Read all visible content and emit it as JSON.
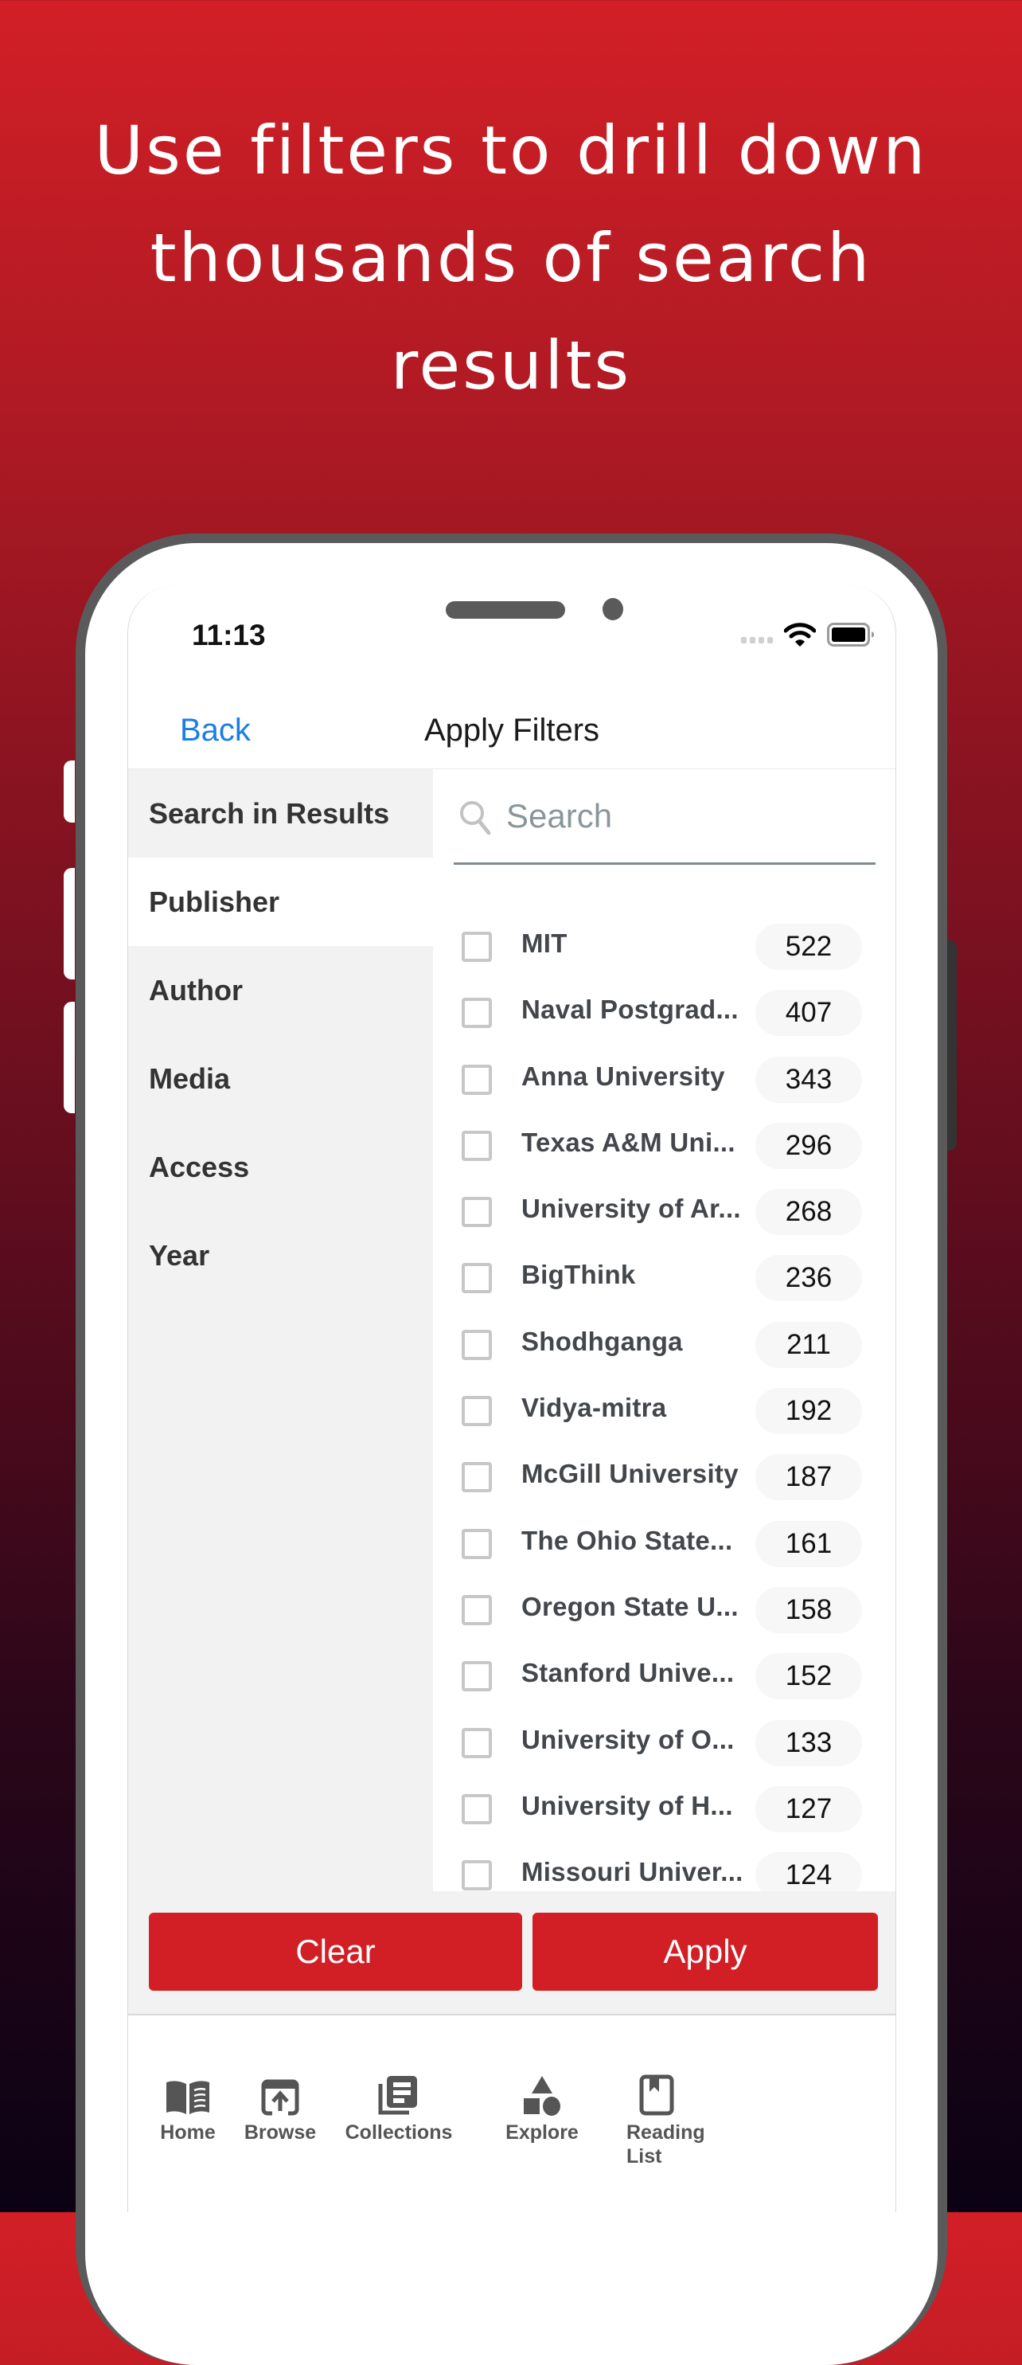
{
  "headline": {
    "lines": [
      "Use filters to drill down",
      "thousands of search",
      "results"
    ]
  },
  "status_bar": {
    "time": "11:13"
  },
  "navbar": {
    "back_label": "Back",
    "title": "Apply Filters"
  },
  "sidebar": {
    "items": [
      {
        "label": "Search in Results",
        "active": false
      },
      {
        "label": "Publisher",
        "active": true
      },
      {
        "label": "Author",
        "active": false
      },
      {
        "label": "Media",
        "active": false
      },
      {
        "label": "Access",
        "active": false
      },
      {
        "label": "Year",
        "active": false
      }
    ]
  },
  "search": {
    "placeholder": "Search",
    "value": ""
  },
  "publishers": [
    {
      "name": "MIT",
      "count": "522",
      "checked": false
    },
    {
      "name": "Naval Postgrad...",
      "count": "407",
      "checked": false
    },
    {
      "name": "Anna University",
      "count": "343",
      "checked": false
    },
    {
      "name": "Texas A&M Uni...",
      "count": "296",
      "checked": false
    },
    {
      "name": "University of Ar...",
      "count": "268",
      "checked": false
    },
    {
      "name": "BigThink",
      "count": "236",
      "checked": false
    },
    {
      "name": "Shodhganga",
      "count": "211",
      "checked": false
    },
    {
      "name": "Vidya-mitra",
      "count": "192",
      "checked": false
    },
    {
      "name": "McGill University",
      "count": "187",
      "checked": false
    },
    {
      "name": "The Ohio State...",
      "count": "161",
      "checked": false
    },
    {
      "name": "Oregon State U...",
      "count": "158",
      "checked": false
    },
    {
      "name": "Stanford Unive...",
      "count": "152",
      "checked": false
    },
    {
      "name": "University of O...",
      "count": "133",
      "checked": false
    },
    {
      "name": "University of H...",
      "count": "127",
      "checked": false
    },
    {
      "name": "Missouri Univer...",
      "count": "124",
      "checked": false
    }
  ],
  "actions": {
    "clear_label": "Clear",
    "apply_label": "Apply"
  },
  "tabbar": {
    "items": [
      {
        "label": "Home",
        "icon": "open-book-icon"
      },
      {
        "label": "Browse",
        "icon": "browse-upload-icon"
      },
      {
        "label": "Collections",
        "icon": "collections-stack-icon"
      },
      {
        "label": "Explore",
        "icon": "shapes-icon"
      },
      {
        "label": "Reading\nList",
        "icon": "bookmark-book-icon"
      }
    ]
  },
  "colors": {
    "brand_red": "#d21f26",
    "link_blue": "#1a7de6",
    "bezel": "#5a5a5a"
  }
}
